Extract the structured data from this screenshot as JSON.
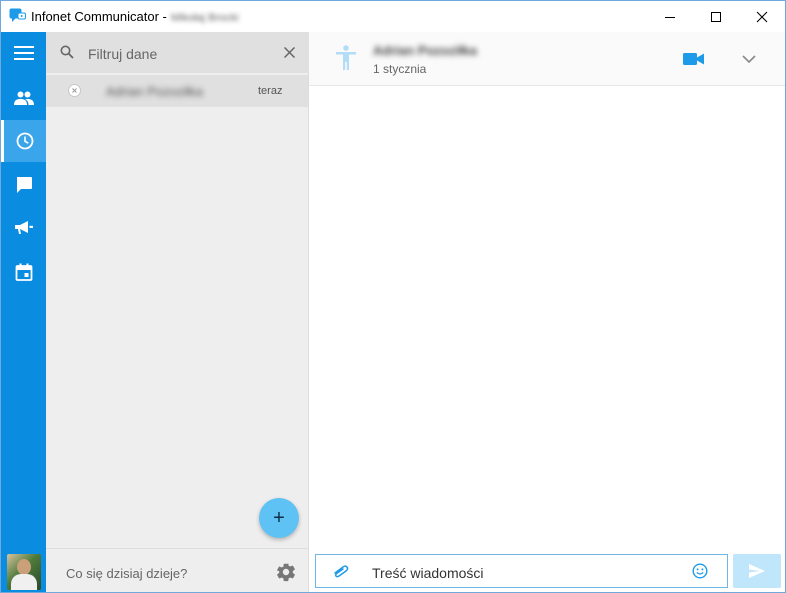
{
  "window": {
    "title": "Infonet Communicator -",
    "user": "Mikołaj Brocki"
  },
  "rail": {
    "items": [
      {
        "name": "menu",
        "icon": "hamburger-icon"
      },
      {
        "name": "contacts",
        "icon": "people-icon"
      },
      {
        "name": "recent",
        "icon": "clock-icon",
        "active": true
      },
      {
        "name": "chats",
        "icon": "chat-bubble-icon"
      },
      {
        "name": "announcements",
        "icon": "megaphone-icon"
      },
      {
        "name": "calendar",
        "icon": "calendar-icon"
      }
    ]
  },
  "filter": {
    "placeholder": "Filtruj dane"
  },
  "conversations": [
    {
      "name": "Adrian Pozoziłka",
      "time": "teraz"
    }
  ],
  "fab": {
    "label": "+"
  },
  "status": {
    "placeholder": "Co się dzisiaj dzieje?"
  },
  "chat": {
    "contact_name": "Adrian Pozoziłka",
    "date": "1 stycznia"
  },
  "composer": {
    "placeholder": "Treść wiadomości"
  },
  "colors": {
    "rail": "#0a8ce0",
    "accent": "#1e9be8",
    "fab": "#5fc2f4",
    "send": "#bfe6fb"
  }
}
